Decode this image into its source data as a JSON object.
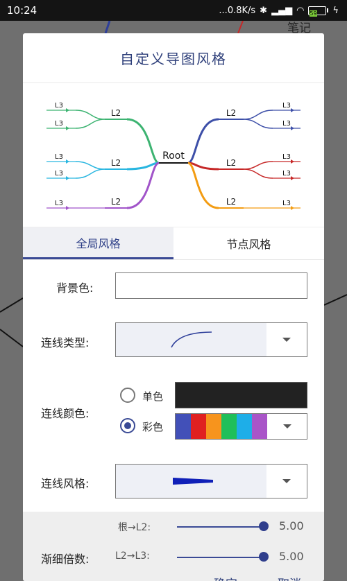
{
  "status_bar": {
    "time": "10:24",
    "network_speed": "...0.8K/s",
    "battery_level": "59"
  },
  "background": {
    "app_title_partial": "笔记"
  },
  "dialog": {
    "title": "自定义导图风格",
    "preview": {
      "root_label": "Root",
      "left": [
        {
          "l2": "L2",
          "l3": [
            "L3",
            "L3"
          ],
          "color": "#3cb371"
        },
        {
          "l2": "L2",
          "l3": [
            "L3",
            "L3"
          ],
          "color": "#29b6e0"
        },
        {
          "l2": "L2",
          "l3": [
            "L3"
          ],
          "color": "#a154c9"
        }
      ],
      "right": [
        {
          "l2": "L2",
          "l3": [
            "L3",
            "L3"
          ],
          "color": "#3d4fa8"
        },
        {
          "l2": "L2",
          "l3": [
            "L3",
            "L3"
          ],
          "color": "#c62828"
        },
        {
          "l2": "L2",
          "l3": [
            "L3"
          ],
          "color": "#f39c12"
        }
      ]
    },
    "tabs": [
      {
        "label": "全局风格",
        "active": true
      },
      {
        "label": "节点风格",
        "active": false
      }
    ],
    "global": {
      "background_color_label": "背景色:",
      "line_type_label": "连线类型:",
      "line_color_label": "连线颜色:",
      "line_color_options": [
        {
          "label": "单色",
          "selected": false,
          "swatch": "#222222"
        },
        {
          "label": "彩色",
          "selected": true,
          "palette": [
            "#4250b8",
            "#e02020",
            "#f7941d",
            "#1fbf5a",
            "#1eaee8",
            "#a955c8"
          ]
        }
      ],
      "line_style_label": "连线风格:",
      "taper": {
        "label": "渐细倍数:",
        "rows": [
          {
            "label": "根→L2:",
            "value": "5.00",
            "fraction": 1.0
          },
          {
            "label": "L2→L3:",
            "value": "5.00",
            "fraction": 1.0
          }
        ]
      }
    },
    "buttons": {
      "confirm": "确定",
      "cancel": "取消"
    }
  }
}
